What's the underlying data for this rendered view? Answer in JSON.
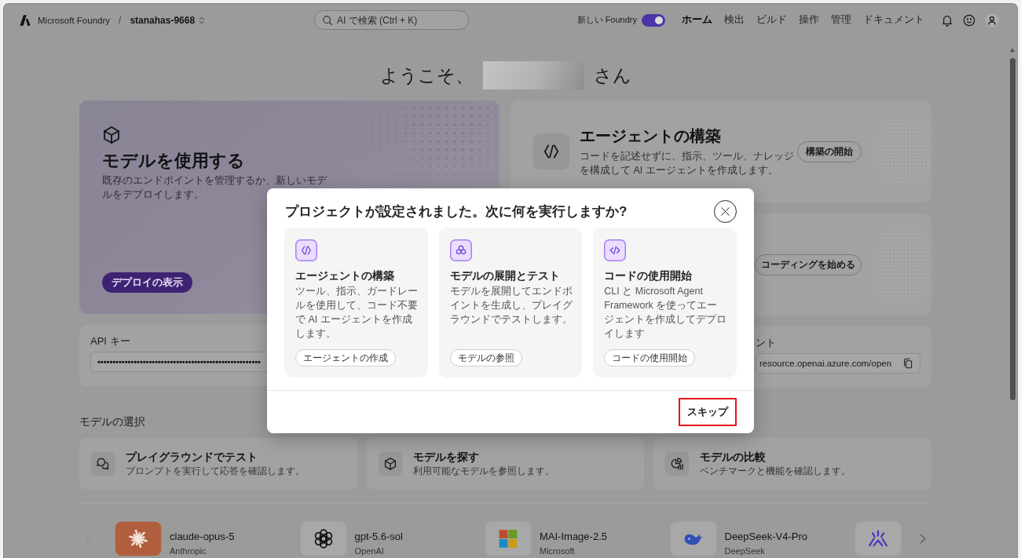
{
  "top_bar": {
    "brand": "Microsoft Foundry",
    "separator": "/",
    "project": "stanahas-9668",
    "search": {
      "placeholder": "AI で検索 (Ctrl + K)"
    },
    "new_foundry": {
      "label": "新しい Foundry",
      "on": true
    },
    "nav": [
      {
        "label": "ホーム",
        "selected": true
      },
      {
        "label": "検出",
        "selected": false
      },
      {
        "label": "ビルド",
        "selected": false
      },
      {
        "label": "操作",
        "selected": false
      },
      {
        "label": "管理",
        "selected": false
      },
      {
        "label": "ドキュメント",
        "selected": false
      }
    ]
  },
  "welcome": {
    "greeting": "ようこそ、",
    "honorific": "さん"
  },
  "hero": {
    "title": "モデルを使用する",
    "description": "既存のエンドポイントを管理するか、新しいモデルをデプロイします。",
    "button": "デプロイの表示"
  },
  "agent_card": {
    "title": "エージェントの構築",
    "description": "コードを記述せずに、指示、ツール、ナレッジを構成して AI エージェントを作成します。",
    "button": "構築の開始"
  },
  "code_card": {
    "button": "コーディングを始める"
  },
  "api_key": {
    "label": "API キー",
    "value": "••••••••••••••••••••••••••••••••••••••••••••••••••••••"
  },
  "endpoint": {
    "label": "ント",
    "value": "resource.openai.azure.com/open"
  },
  "model_section": {
    "title": "モデルの選択",
    "cards": [
      {
        "title": "プレイグラウンドでテスト",
        "description": "プロンプトを実行して応答を確認します。"
      },
      {
        "title": "モデルを探す",
        "description": "利用可能なモデルを参照します。"
      },
      {
        "title": "モデルの比較",
        "description": "ベンチマークと機能を確認します。"
      }
    ]
  },
  "carousel": {
    "prev": {
      "disabled": true
    },
    "next": {
      "disabled": false
    },
    "models": [
      {
        "name": "claude-opus-5",
        "publisher": "Anthropic"
      },
      {
        "name": "gpt-5.6-sol",
        "publisher": "OpenAI"
      },
      {
        "name": "MAI-Image-2.5",
        "publisher": "Microsoft"
      },
      {
        "name": "DeepSeek-V4-Pro",
        "publisher": "DeepSeek"
      }
    ]
  },
  "dialog": {
    "title": "プロジェクトが設定されました。次に何を実行しますか?",
    "options": [
      {
        "title": "エージェントの構築",
        "description": "ツール、指示、ガードレールを使用して、コード不要で AI エージェントを作成します。",
        "button": "エージェントの作成"
      },
      {
        "title": "モデルの展開とテスト",
        "description": "モデルを展開してエンドポイントを生成し、プレイグラウンドでテストします。",
        "button": "モデルの参照"
      },
      {
        "title": "コードの使用開始",
        "description": "CLI と Microsoft Agent Framework を使ってエージェントを作成してデプロイします",
        "button": "コードの使用開始"
      }
    ],
    "skip": {
      "label": "スキップ",
      "highlighted": true
    }
  }
}
